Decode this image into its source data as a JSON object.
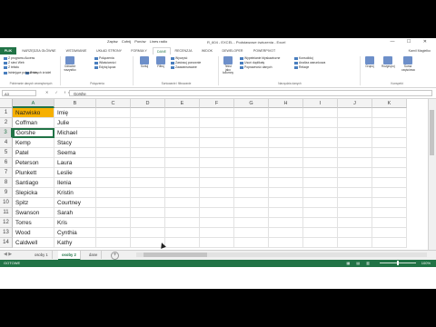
{
  "window": {
    "title": "R_604 - EXCEL - Podstawowe ćwiczenia - Excel",
    "quick_access": [
      "Zapisz",
      "Cofnij",
      "Ponów",
      "Lines radio"
    ],
    "controls": "— ☐ ✕"
  },
  "ribbon": {
    "tabs": [
      "PLIK",
      "NARZĘDZIA GŁÓWNE",
      "WSTAWIANIE",
      "UKŁAD STRONY",
      "FORMUŁY",
      "DANE",
      "RECENZJA",
      "WIDOK",
      "DEWELOPER",
      "POWERPIVOT"
    ],
    "active_tab": "DANE",
    "user": "Kamil Magiełko",
    "groups": [
      {
        "name": "Pobieranie danych zewnętrznych",
        "items": [
          "Z programu Access",
          "Z sieci Web",
          "Z tekstu",
          "Z innych źródeł",
          "Istniejące połączenia"
        ]
      },
      {
        "name": "Połączenia",
        "items": [
          "Odśwież wszystko",
          "Połączenia",
          "Właściwości",
          "Edytuj łącza"
        ]
      },
      {
        "name": "Sortowanie i filtrowanie",
        "items": [
          "Sortuj",
          "Filtruj",
          "Wyczyść",
          "Zastosuj ponownie",
          "Zaawansowane"
        ]
      },
      {
        "name": "Narzędzia danych",
        "items": [
          "Tekst jako kolumny",
          "Wypełnianie błyskawiczne",
          "Usuń duplikaty",
          "Poprawność danych",
          "Konsoliduj",
          "Analiza warunkowa",
          "Relacje"
        ]
      },
      {
        "name": "Konspekt",
        "items": [
          "Grupuj",
          "Rozgrupuj",
          "Suma częściowa"
        ]
      }
    ]
  },
  "formula_bar": {
    "name_box": "A3",
    "fx_buttons": "✕ ✓ fx",
    "value": "Gorshe"
  },
  "columns": [
    "A",
    "B",
    "C",
    "D",
    "E",
    "F",
    "G",
    "H",
    "I",
    "J",
    "K"
  ],
  "rows": [
    {
      "n": "1",
      "a": "Nazwisko",
      "b": "Imię"
    },
    {
      "n": "2",
      "a": "Coffman",
      "b": "Julie"
    },
    {
      "n": "3",
      "a": "Gorshe",
      "b": "Michael"
    },
    {
      "n": "4",
      "a": "Kemp",
      "b": "Stacy"
    },
    {
      "n": "5",
      "a": "Patel",
      "b": "Seema"
    },
    {
      "n": "6",
      "a": "Peterson",
      "b": "Laura"
    },
    {
      "n": "7",
      "a": "Plunkett",
      "b": "Leslie"
    },
    {
      "n": "8",
      "a": "Santiago",
      "b": "Ilenia"
    },
    {
      "n": "9",
      "a": "Slepicka",
      "b": "Kristin"
    },
    {
      "n": "10",
      "a": "Spitz",
      "b": "Courtney"
    },
    {
      "n": "11",
      "a": "Swanson",
      "b": "Sarah"
    },
    {
      "n": "12",
      "a": "Torres",
      "b": "Kris"
    },
    {
      "n": "13",
      "a": "Wood",
      "b": "Cynthia"
    },
    {
      "n": "14",
      "a": "Caldwell",
      "b": "Kathy"
    }
  ],
  "sheets": {
    "tabs": [
      "osoby 1",
      "osoby 2",
      "dane"
    ],
    "active": "osoby 2",
    "nav": "◀ ▶",
    "add": "+"
  },
  "status": {
    "mode": "GOTOWE",
    "zoom": "100%",
    "view_icons": "▦ ▤ ▥",
    "zoom_controls": "−  +"
  },
  "colors": {
    "accent": "#217346",
    "header_fill": "#f6b000"
  }
}
